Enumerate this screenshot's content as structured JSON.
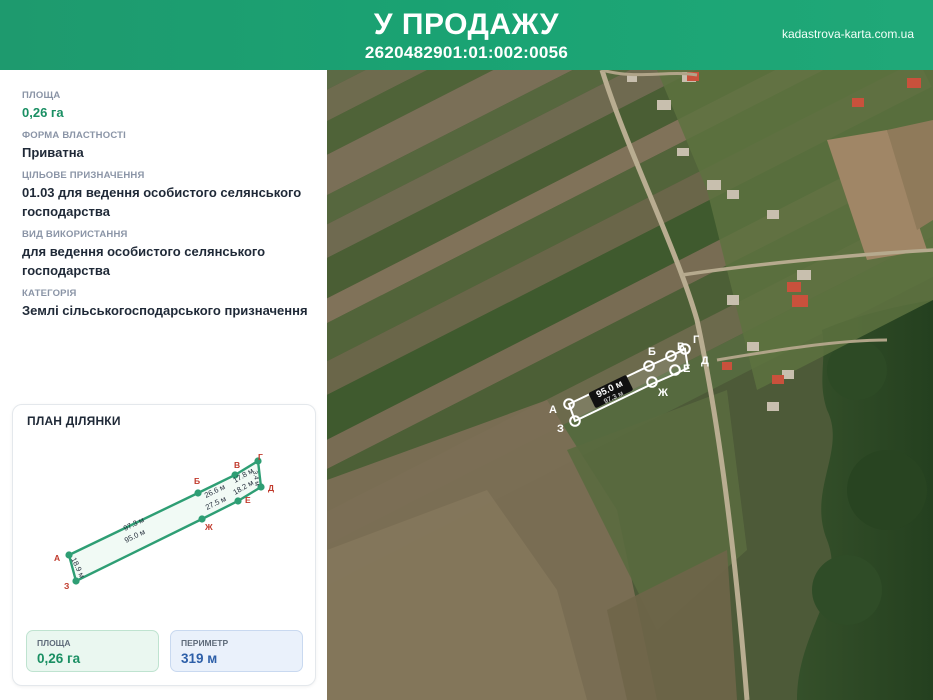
{
  "header": {
    "title": "У ПРОДАЖУ",
    "cadastral": "2620482901:01:002:0056",
    "site": "kadastrova-karta.com.ua"
  },
  "details": [
    {
      "label": "ПЛОЩА",
      "value": "0,26 га"
    },
    {
      "label": "ФОРМА ВЛАСТНОСТІ",
      "value": "Приватна"
    },
    {
      "label": "ЦІЛЬОВЕ ПРИЗНАЧЕННЯ",
      "value": "01.03 для ведення особистого селянського господарства"
    },
    {
      "label": "ВИД ВИКОРИСТАННЯ",
      "value": "для ведення особистого селянського господарства"
    },
    {
      "label": "КАТЕГОРІЯ",
      "value": "Землі сільськогосподарського призначення"
    }
  ],
  "plan": {
    "title": "ПЛАН ДІЛЯНКИ",
    "points": [
      "А",
      "Б",
      "В",
      "Г",
      "Д",
      "Е",
      "Ж",
      "З"
    ],
    "segments": [
      "97.3 м",
      "95.0 м",
      "26.6 м",
      "27.5 м",
      "17.8 м",
      "18.2 м",
      "18.9 м",
      "3.4 м"
    ]
  },
  "stats": {
    "area_label": "ПЛОЩА",
    "area_value": "0,26 га",
    "perimeter_label": "ПЕРИМЕТР",
    "perimeter_value": "319 м"
  },
  "map": {
    "length_label": "95.0 м",
    "length_label_2": "97.3 м",
    "points": [
      "А",
      "Б",
      "В",
      "Г",
      "Д",
      "Е",
      "Ж",
      "З"
    ]
  },
  "colors": {
    "brand": "#1a9e70",
    "parcel_line": "#2e9e74",
    "point_label": "#c0392b"
  }
}
